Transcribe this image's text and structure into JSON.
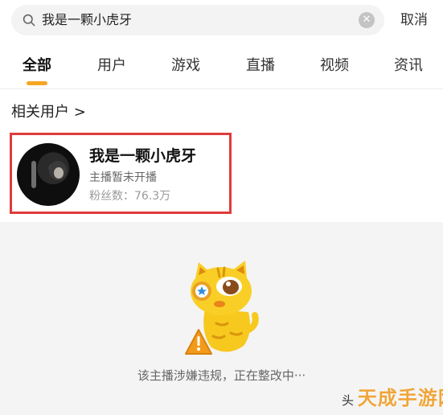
{
  "search": {
    "query": "我是一颗小虎牙",
    "cancel_label": "取消"
  },
  "tabs": [
    {
      "label": "全部",
      "active": true
    },
    {
      "label": "用户",
      "active": false
    },
    {
      "label": "游戏",
      "active": false
    },
    {
      "label": "直播",
      "active": false
    },
    {
      "label": "视频",
      "active": false
    },
    {
      "label": "资讯",
      "active": false
    }
  ],
  "related_users": {
    "title": "相关用户 >",
    "user": {
      "name": "我是一颗小虎牙",
      "status": "主播暂未开播",
      "fans": "粉丝数：76.3万"
    }
  },
  "empty_state": {
    "message": "该主播涉嫌违规，正在整改中···"
  },
  "watermark": {
    "prefix": "头",
    "brand": "天成手游网"
  },
  "colors": {
    "accent": "#f5a623",
    "highlight_border": "#e03b3b",
    "empty_bg": "#f4f4f4"
  }
}
